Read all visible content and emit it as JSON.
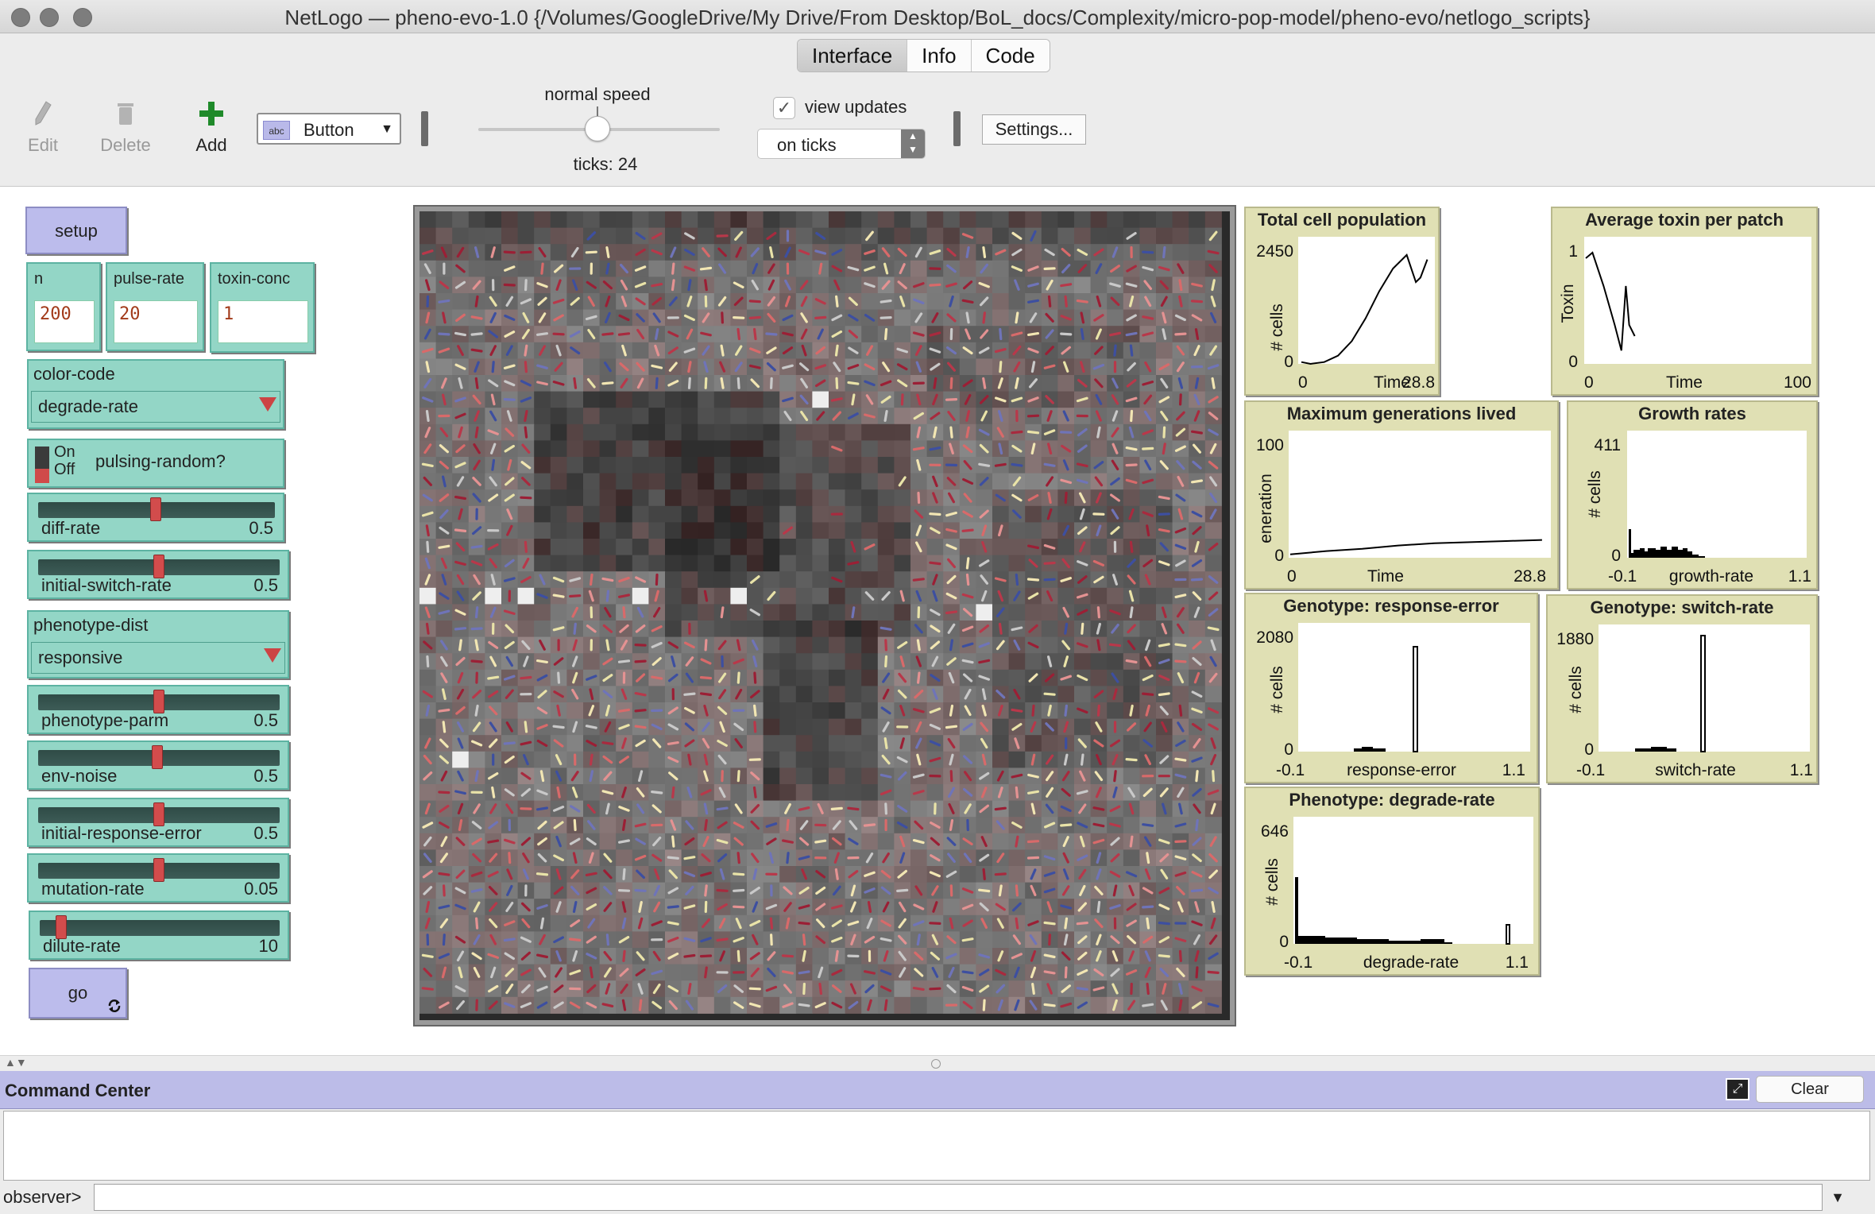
{
  "window": {
    "title": "NetLogo — pheno-evo-1.0 {/Volumes/GoogleDrive/My Drive/From Desktop/BoL_docs/Complexity/micro-pop-model/pheno-evo/netlogo_scripts}"
  },
  "tabs": [
    {
      "label": "Interface",
      "active": true
    },
    {
      "label": "Info",
      "active": false
    },
    {
      "label": "Code",
      "active": false
    }
  ],
  "toolbar": {
    "edit_label": "Edit",
    "delete_label": "Delete",
    "add_label": "Add",
    "widget_type": "Button",
    "widget_type_icon_text": "abc",
    "speed_label": "normal speed",
    "ticks_label": "ticks: 24",
    "view_updates_label": "view updates",
    "view_updates_checked": true,
    "update_mode": "on ticks",
    "settings_label": "Settings..."
  },
  "widgets": {
    "setup_label": "setup",
    "go_label": "go",
    "go_forever_icon": "forever-icon",
    "inputs": [
      {
        "name": "n",
        "value": "200"
      },
      {
        "name": "pulse-rate",
        "value": "20"
      },
      {
        "name": "toxin-conc",
        "value": "1"
      }
    ],
    "color_code": {
      "name": "color-code",
      "value": "degrade-rate"
    },
    "pulsing_switch": {
      "on": "On",
      "off": "Off",
      "name": "pulsing-random?",
      "state": "off"
    },
    "sliders_a": [
      {
        "name": "diff-rate",
        "value": "0.5",
        "fraction": 0.5
      },
      {
        "name": "initial-switch-rate",
        "value": "0.5",
        "fraction": 0.5
      }
    ],
    "phenotype_dist": {
      "name": "phenotype-dist",
      "value": "responsive"
    },
    "sliders_b": [
      {
        "name": "phenotype-parm",
        "value": "0.5",
        "fraction": 0.5
      },
      {
        "name": "env-noise",
        "value": "0.5",
        "fraction": 0.5
      },
      {
        "name": "initial-response-error",
        "value": "0.5",
        "fraction": 0.5
      },
      {
        "name": "mutation-rate",
        "value": "0.05",
        "fraction": 0.5
      },
      {
        "name": "dilute-rate",
        "value": "10",
        "fraction": 0.05
      }
    ]
  },
  "plots": {
    "total_population": {
      "title": "Total cell population",
      "ylabel": "# cells",
      "xlabel": "Time",
      "xmin": "0",
      "xmax": "28.8",
      "ymin": "0",
      "ymax": "2450"
    },
    "avg_toxin": {
      "title": "Average toxin per patch",
      "ylabel": "Toxin",
      "xlabel": "Time",
      "xmin": "0",
      "xmax": "100",
      "ymin": "0",
      "ymax": "1"
    },
    "max_generations": {
      "title": "Maximum generations lived",
      "ylabel": "eneration",
      "xlabel": "Time",
      "xmin": "0",
      "xmax": "28.8",
      "ymin": "0",
      "ymax": "100"
    },
    "growth_rates": {
      "title": "Growth rates",
      "ylabel": "# cells",
      "xlabel": "growth-rate",
      "xmin": "-0.1",
      "xmax": "1.1",
      "ymin": "0",
      "ymax": "411"
    },
    "response_error": {
      "title": "Genotype: response-error",
      "ylabel": "# cells",
      "xlabel": "response-error",
      "xmin": "-0.1",
      "xmax": "1.1",
      "ymin": "0",
      "ymax": "2080"
    },
    "switch_rate": {
      "title": "Genotype: switch-rate",
      "ylabel": "# cells",
      "xlabel": "switch-rate",
      "xmin": "-0.1",
      "xmax": "1.1",
      "ymin": "0",
      "ymax": "1880"
    },
    "degrade_rate": {
      "title": "Phenotype: degrade-rate",
      "ylabel": "# cells",
      "xlabel": "degrade-rate",
      "xmin": "-0.1",
      "xmax": "1.1",
      "ymin": "0",
      "ymax": "646"
    }
  },
  "chart_data": [
    {
      "type": "line",
      "title": "Total cell population",
      "xlabel": "Time",
      "ylabel": "# cells",
      "xlim": [
        0,
        28.8
      ],
      "ylim": [
        0,
        2450
      ],
      "x": [
        0,
        2,
        5,
        8,
        11,
        14,
        17,
        20,
        23,
        25,
        26,
        27.5
      ],
      "y": [
        40,
        0,
        40,
        180,
        500,
        1000,
        1600,
        2100,
        2400,
        1800,
        1900,
        2300
      ]
    },
    {
      "type": "line",
      "title": "Average toxin per patch",
      "xlabel": "Time",
      "ylabel": "Toxin",
      "xlim": [
        0,
        100
      ],
      "ylim": [
        0,
        1
      ],
      "x": [
        0,
        3,
        8,
        13,
        16,
        18,
        19.5,
        22
      ],
      "y": [
        0.95,
        1.0,
        0.7,
        0.35,
        0.12,
        0.7,
        0.35,
        0.25
      ]
    },
    {
      "type": "line",
      "title": "Maximum generations lived",
      "xlabel": "Time",
      "ylabel": "eneration",
      "xlim": [
        0,
        28.8
      ],
      "ylim": [
        0,
        100
      ],
      "x": [
        0,
        4,
        8,
        12,
        16,
        20,
        24,
        28
      ],
      "y": [
        3,
        6,
        8,
        11,
        13,
        14,
        15,
        16
      ]
    }
  ],
  "command_center": {
    "title": "Command Center",
    "clear_label": "Clear",
    "prompt": "observer>"
  }
}
